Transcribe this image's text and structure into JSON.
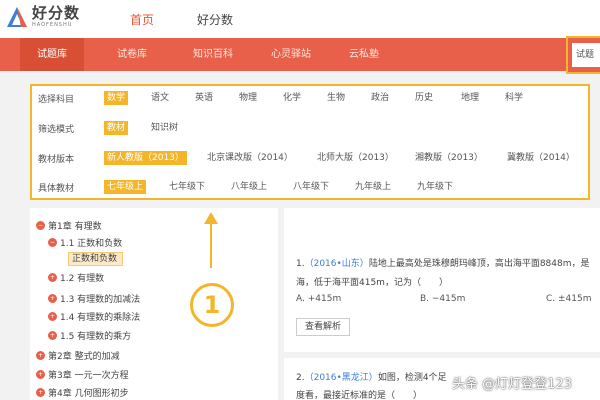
{
  "header": {
    "logo_name": "好分数",
    "logo_sub": "HAOFENSHU",
    "nav": [
      "首页",
      "好分数"
    ]
  },
  "main_nav": {
    "items": [
      "试题库",
      "试卷库",
      "知识百科",
      "心灵驿站",
      "云私塾"
    ],
    "active_index": 0,
    "search_label": "试题"
  },
  "filters": [
    {
      "label": "选择科目",
      "options": [
        "数学",
        "语文",
        "英语",
        "物理",
        "化学",
        "生物",
        "政治",
        "历史",
        "地理",
        "科学"
      ],
      "selected": 0
    },
    {
      "label": "筛选模式",
      "options": [
        "教材",
        "知识树"
      ],
      "selected": 0
    },
    {
      "label": "教材版本",
      "options": [
        "新人教版（2013）",
        "北京课改版（2014）",
        "北师大版（2013）",
        "湘教版（2013）",
        "冀教版（2014）"
      ],
      "selected": 0
    },
    {
      "label": "具体教材",
      "options": [
        "七年级上",
        "七年级下",
        "八年级上",
        "八年级下",
        "九年级上",
        "九年级下"
      ],
      "selected": 0
    }
  ],
  "tree": [
    {
      "label": "第1章 有理数",
      "icon": "minus-icon"
    },
    {
      "label": "1.1 正数和负数",
      "icon": "minus-icon"
    },
    {
      "label": "正数和负数",
      "selected": true
    },
    {
      "label": "1.2 有理数",
      "icon": "plus-icon"
    },
    {
      "label": "1.3 有理数的加减法",
      "icon": "plus-icon"
    },
    {
      "label": "1.4 有理数的乘除法",
      "icon": "plus-icon"
    },
    {
      "label": "1.5 有理数的乘方",
      "icon": "plus-icon"
    },
    {
      "label": "第2章 整式的加减",
      "icon": "plus-icon"
    },
    {
      "label": "第3章 一元一次方程",
      "icon": "plus-icon"
    },
    {
      "label": "第4章 几何图形初步",
      "icon": "plus-icon"
    }
  ],
  "questions": [
    {
      "number": "1.",
      "source": "（2016•山东）",
      "line1": "陆地上最高处是珠穆朗玛峰顶，高出海平面8848m，是",
      "line2": "海，低于海平面415m，记为（　　）",
      "options": [
        "A. +415m",
        "B. −415m",
        "C. ±415m"
      ],
      "analysis_label": "查看解析"
    },
    {
      "number": "2.",
      "source": "（2016•黑龙江）",
      "line1": "如图，检测4个足",
      "line2": "度看，最接近标准的是（　　）"
    }
  ],
  "callout": {
    "number": "1"
  },
  "watermark": "头条 @灯灯登登123",
  "colors": {
    "accent": "#e8604a",
    "highlight": "#f3b52a",
    "link": "#3c7fd6"
  }
}
